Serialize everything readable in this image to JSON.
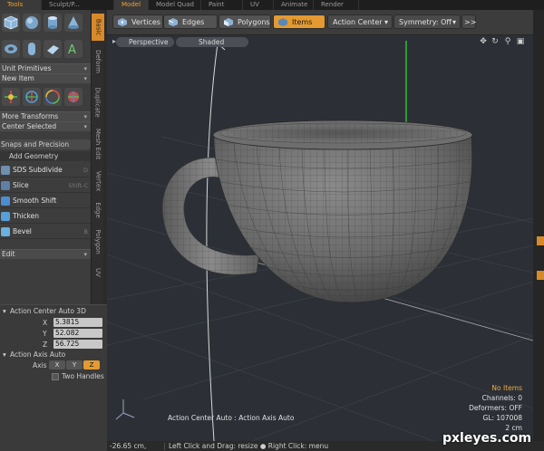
{
  "top_tabs": [
    "Tools",
    "Sculpt/P...",
    "Model",
    "Model Quad",
    "Paint",
    "UV",
    "Animate",
    "Render"
  ],
  "left_panel": {
    "tool_icons_row1": [
      "cube-icon",
      "sphere-icon",
      "cylinder-icon",
      "cone-icon"
    ],
    "tool_icons_row2": [
      "torus-icon",
      "capsule-icon",
      "plane-icon",
      "text-icon"
    ],
    "unit_primitives": "Unit Primitives",
    "new_item": "New Item",
    "transform_icons": [
      "move-icon",
      "rotate-icon",
      "scale-icon",
      "transform-icon"
    ],
    "more_transforms": "More Transforms",
    "center_selected": "Center Selected",
    "snaps_and_precision": "Snaps and Precision",
    "add_geometry": "Add Geometry",
    "geometry_items": [
      {
        "label": "SDS Subdivide",
        "shortcut": "D"
      },
      {
        "label": "Slice",
        "shortcut": "Shift-C"
      },
      {
        "label": "Smooth Shift",
        "shortcut": ""
      },
      {
        "label": "Thicken",
        "shortcut": ""
      },
      {
        "label": "Bevel",
        "shortcut": "B"
      }
    ],
    "edit": "Edit"
  },
  "vertical_tabs": [
    "Basic",
    "Deform",
    "Duplicate",
    "Mesh Edit",
    "Vertex",
    "Edge",
    "Polygon",
    "UV"
  ],
  "properties": {
    "section_title": "Action Center Auto 3D",
    "x_label": "X",
    "x_value": "5.3815",
    "y_label": "Y",
    "y_value": "52.082",
    "z_label": "Z",
    "z_value": "56.725",
    "axis_section": "Action Axis Auto",
    "axis_label": "Axis",
    "axis_options": [
      "X",
      "Y",
      "Z"
    ],
    "axis_selected": "Z",
    "two_handles": "Two Handles"
  },
  "toolbar": {
    "vertices": "Vertices",
    "edges": "Edges",
    "polygons": "Polygons",
    "items": "Items",
    "action_center": "Action Center",
    "symmetry": "Symmetry: Off",
    "more": ">>"
  },
  "viewport": {
    "view_mode": "Perspective",
    "shading_mode": "Shaded",
    "info_no_items": "No Items",
    "info_channels": "Channels: 0",
    "info_deformers": "Deformers: OFF",
    "info_gl": "GL: 107008",
    "info_scale": "2 cm",
    "status_text": "Action Center Auto : Action Axis Auto"
  },
  "status_bar": {
    "coord": "-26.65 cm,",
    "hint": "Left Click and Drag: resize ● Right Click: menu"
  },
  "watermark": "pxleyes.com",
  "colors": {
    "accent": "#e49a30",
    "viewport_bg": "#2c3036",
    "panel_bg": "#3d3d3d"
  }
}
